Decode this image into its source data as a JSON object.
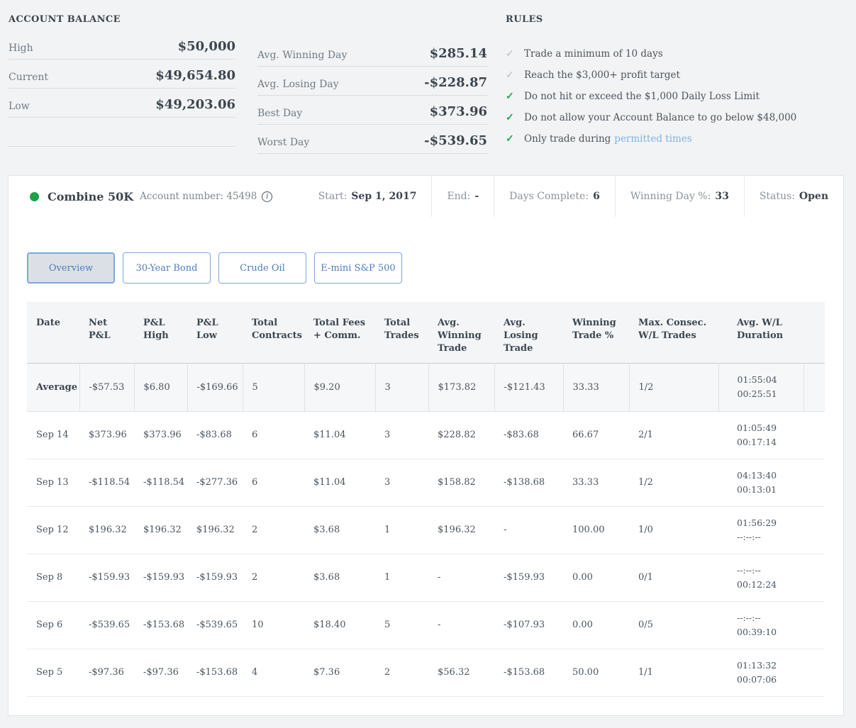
{
  "account_balance": {
    "title": "ACCOUNT BALANCE",
    "rows": [
      {
        "label": "High",
        "value": "$50,000"
      },
      {
        "label": "Current",
        "value": "$49,654.80"
      },
      {
        "label": "Low",
        "value": "$49,203.06"
      },
      {
        "label": "",
        "value": ""
      }
    ]
  },
  "day_stats": {
    "rows": [
      {
        "label": "Avg. Winning Day",
        "value": "$285.14"
      },
      {
        "label": "Avg. Losing Day",
        "value": "-$228.87"
      },
      {
        "label": "Best Day",
        "value": "$373.96"
      },
      {
        "label": "Worst Day",
        "value": "-$539.65"
      }
    ]
  },
  "rules": {
    "title": "RULES",
    "items": [
      {
        "text": "Trade a minimum of 10 days",
        "status": "pending"
      },
      {
        "text": "Reach the $3,000+ profit target",
        "status": "pending"
      },
      {
        "text": "Do not hit or exceed the $1,000 Daily Loss Limit",
        "status": "met"
      },
      {
        "text": "Do not allow your Account Balance to go below $48,000",
        "status": "met"
      },
      {
        "text": "Only trade during",
        "link_text": "permitted times",
        "status": "met"
      }
    ]
  },
  "combine": {
    "name": "Combine 50K",
    "account_label": "Account number: 45498",
    "info_icon_glyph": "i",
    "stats": [
      {
        "label": "Start:",
        "value": "Sep 1, 2017"
      },
      {
        "label": "End:",
        "value": "-"
      },
      {
        "label": "Days Complete:",
        "value": "6"
      },
      {
        "label": "Winning Day %:",
        "value": "33"
      },
      {
        "label": "Status:",
        "value": "Open"
      }
    ]
  },
  "tabs": [
    {
      "label": "Overview",
      "active": true
    },
    {
      "label": "30-Year Bond",
      "active": false
    },
    {
      "label": "Crude Oil",
      "active": false
    },
    {
      "label": "E-mini S&P 500",
      "active": false
    }
  ],
  "table": {
    "columns": [
      "Date",
      "Net P&L",
      "P&L High",
      "P&L Low",
      "Total Contracts",
      "Total Fees + Comm.",
      "Total Trades",
      "Avg. Winning Trade",
      "Avg. Losing Trade",
      "Winning Trade %",
      "Max. Consec. W/L Trades",
      "Avg. W/L Duration"
    ],
    "average_row": {
      "date": "Average",
      "net_pnl": "-$57.53",
      "pnl_high": "$6.80",
      "pnl_low": "-$169.66",
      "total_contracts": "5",
      "total_fees": "$9.20",
      "total_trades": "3",
      "avg_winning_trade": "$173.82",
      "avg_losing_trade": "-$121.43",
      "winning_trade_pct": "33.33",
      "max_consec_wl": "1/2",
      "duration_win": "01:55:04",
      "duration_loss": "00:25:51"
    },
    "rows": [
      {
        "date": "Sep 14",
        "net_pnl": "$373.96",
        "pnl_high": "$373.96",
        "pnl_low": "-$83.68",
        "total_contracts": "6",
        "total_fees": "$11.04",
        "total_trades": "3",
        "avg_winning_trade": "$228.82",
        "avg_losing_trade": "-$83.68",
        "winning_trade_pct": "66.67",
        "max_consec_wl": "2/1",
        "duration_win": "01:05:49",
        "duration_loss": "00:17:14"
      },
      {
        "date": "Sep 13",
        "net_pnl": "-$118.54",
        "pnl_high": "-$118.54",
        "pnl_low": "-$277.36",
        "total_contracts": "6",
        "total_fees": "$11.04",
        "total_trades": "3",
        "avg_winning_trade": "$158.82",
        "avg_losing_trade": "-$138.68",
        "winning_trade_pct": "33.33",
        "max_consec_wl": "1/2",
        "duration_win": "04:13:40",
        "duration_loss": "00:13:01"
      },
      {
        "date": "Sep 12",
        "net_pnl": "$196.32",
        "pnl_high": "$196.32",
        "pnl_low": "$196.32",
        "total_contracts": "2",
        "total_fees": "$3.68",
        "total_trades": "1",
        "avg_winning_trade": "$196.32",
        "avg_losing_trade": "-",
        "winning_trade_pct": "100.00",
        "max_consec_wl": "1/0",
        "duration_win": "01:56:29",
        "duration_loss": "--:--:--"
      },
      {
        "date": "Sep 8",
        "net_pnl": "-$159.93",
        "pnl_high": "-$159.93",
        "pnl_low": "-$159.93",
        "total_contracts": "2",
        "total_fees": "$3.68",
        "total_trades": "1",
        "avg_winning_trade": "-",
        "avg_losing_trade": "-$159.93",
        "winning_trade_pct": "0.00",
        "max_consec_wl": "0/1",
        "duration_win": "--:--:--",
        "duration_loss": "00:12:24"
      },
      {
        "date": "Sep 6",
        "net_pnl": "-$539.65",
        "pnl_high": "-$153.68",
        "pnl_low": "-$539.65",
        "total_contracts": "10",
        "total_fees": "$18.40",
        "total_trades": "5",
        "avg_winning_trade": "-",
        "avg_losing_trade": "-$107.93",
        "winning_trade_pct": "0.00",
        "max_consec_wl": "0/5",
        "duration_win": "--:--:--",
        "duration_loss": "00:39:10"
      },
      {
        "date": "Sep 5",
        "net_pnl": "-$97.36",
        "pnl_high": "-$97.36",
        "pnl_low": "-$153.68",
        "total_contracts": "4",
        "total_fees": "$7.36",
        "total_trades": "2",
        "avg_winning_trade": "$56.32",
        "avg_losing_trade": "-$153.68",
        "winning_trade_pct": "50.00",
        "max_consec_wl": "1/1",
        "duration_win": "01:13:32",
        "duration_loss": "00:07:06"
      }
    ]
  },
  "colors": {
    "accent_green": "#1fa750",
    "pending_gray": "#c8cdd2",
    "link_blue": "#82b2e2",
    "tab_blue": "#4d7fbb"
  }
}
